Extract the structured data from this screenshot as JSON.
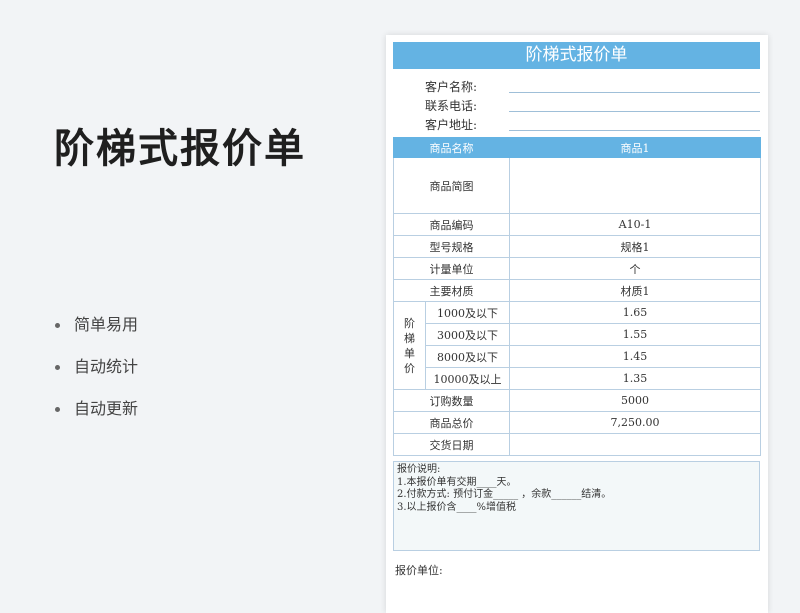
{
  "hero": {
    "title": "阶梯式报价单"
  },
  "features": [
    "简单易用",
    "自动统计",
    "自动更新"
  ],
  "sheet": {
    "title": "阶梯式报价单",
    "client": [
      "客户名称:",
      "联系电话:",
      "客户地址:"
    ],
    "header": {
      "label": "商品名称",
      "value": "商品1"
    },
    "image_label": "商品简图",
    "rows_top": [
      {
        "label": "商品编码",
        "value": "A10-1"
      },
      {
        "label": "型号规格",
        "value": "规格1"
      },
      {
        "label": "计量单位",
        "value": "个"
      },
      {
        "label": "主要材质",
        "value": "材质1"
      }
    ],
    "tier_label": [
      "阶",
      "梯",
      "单",
      "价"
    ],
    "tiers": [
      {
        "label": "1000及以下",
        "value": "1.65"
      },
      {
        "label": "3000及以下",
        "value": "1.55"
      },
      {
        "label": "8000及以下",
        "value": "1.45"
      },
      {
        "label": "10000及以上",
        "value": "1.35"
      }
    ],
    "rows_bottom": [
      {
        "label": "订购数量",
        "value": "5000"
      },
      {
        "label": "商品总价",
        "value": "7,250.00"
      },
      {
        "label": "交货日期",
        "value": ""
      }
    ],
    "notes": {
      "title": "报价说明:",
      "lines": [
        "1.本报价单有交期____天。",
        "2.付款方式: 预付订金_____ ，余款______结清。",
        "3.以上报价含____%增值税"
      ]
    },
    "footer": "报价单位:"
  }
}
